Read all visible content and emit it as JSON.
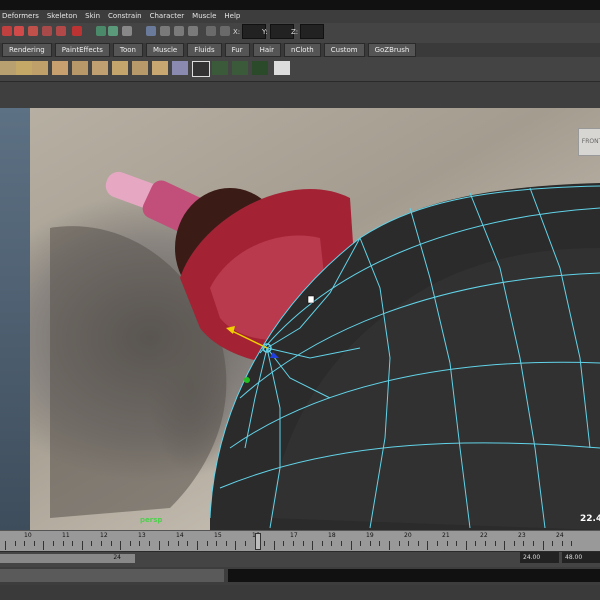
{
  "menu": {
    "items": [
      "Deformers",
      "Skeleton",
      "Skin",
      "Constrain",
      "Character",
      "Muscle",
      "Help"
    ]
  },
  "xyz": {
    "x_label": "X:",
    "y_label": "Y:",
    "z_label": "Z:"
  },
  "shelf_tabs": [
    "Rendering",
    "PaintEffects",
    "Toon",
    "Muscle",
    "Fluids",
    "Fur",
    "Hair",
    "nCloth",
    "Custom",
    "GoZBrush"
  ],
  "viewport": {
    "camera_label": "persp",
    "fps": "22.4",
    "view_cube": "FRONT"
  },
  "timeline": {
    "ticks": [
      "10",
      "11",
      "12",
      "13",
      "14",
      "15",
      "16",
      "17",
      "18",
      "19",
      "20",
      "21",
      "22",
      "23",
      "24"
    ]
  },
  "range": {
    "end_inner": "24",
    "playback_end": "24.00",
    "anim_end": "48.00"
  },
  "colors": {
    "wire": "#62d3e8",
    "bg": "#444444",
    "persp_green": "#4fd04f"
  }
}
